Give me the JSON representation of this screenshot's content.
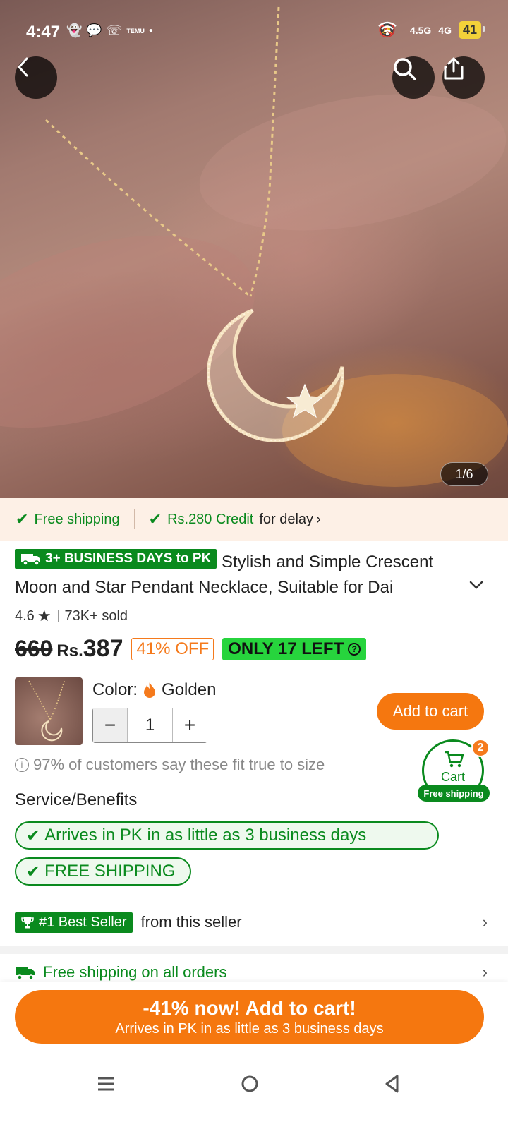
{
  "status_bar": {
    "time": "4:47",
    "left_icons": [
      "snapchat-icon",
      "chat-bubble-icon",
      "whatsapp-icon",
      "temu-icon",
      "dot-icon"
    ],
    "right_icons": [
      "mute-icon",
      "wifi-icon",
      "signal-4.5g-icon",
      "signal-4g-icon"
    ],
    "network_1": "4.5G",
    "network_2": "4G",
    "battery": "41"
  },
  "gallery": {
    "counter": "1/6"
  },
  "shipping_strip": {
    "free_shipping": "Free shipping",
    "credit": "Rs.280 Credit",
    "credit_suffix": "for delay"
  },
  "product": {
    "days_badge": "3+ BUSINESS DAYS to PK",
    "title": "Stylish and Simple Crescent Moon and Star Pendant Necklace, Suitable for Dai",
    "rating": "4.6",
    "sold": "73K+ sold",
    "old_price": "660",
    "currency": "Rs.",
    "price": "387",
    "discount": "41% OFF",
    "stock": "ONLY 17 LEFT"
  },
  "variant": {
    "color_label": "Color:",
    "color_value": "Golden",
    "quantity": "1",
    "add_to_cart": "Add to cart"
  },
  "fit_note": "97% of customers say these fit true to size",
  "cart": {
    "label": "Cart",
    "count": "2",
    "free_shipping": "Free shipping"
  },
  "services": {
    "title": "Service/Benefits",
    "items": [
      "Arrives in PK in as little as 3 business days",
      "FREE SHIPPING"
    ]
  },
  "seller": {
    "badge": "#1 Best Seller",
    "text": "from this seller"
  },
  "free_all": "Free shipping on all orders",
  "cta": {
    "main": "-41% now! Add to cart!",
    "sub": "Arrives in PK in as little as 3 business days"
  },
  "colors": {
    "accent_orange": "#f5770f",
    "accent_green": "#0a8a1e",
    "stock_green": "#27d43d"
  }
}
